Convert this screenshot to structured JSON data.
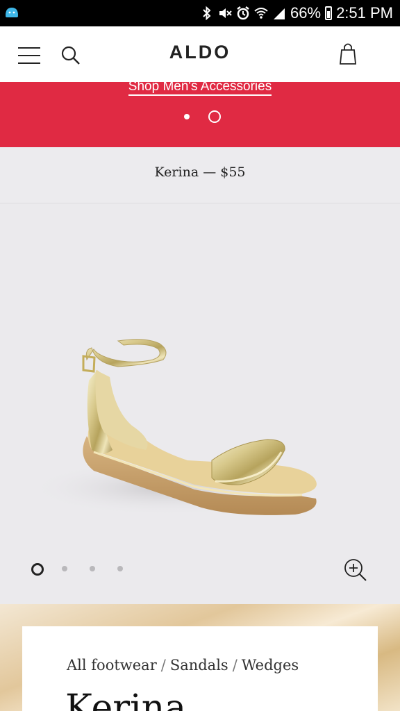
{
  "status_bar": {
    "battery": "66%",
    "time": "2:51 PM",
    "icons": [
      "app-notification-icon",
      "bluetooth-icon",
      "mute-icon",
      "alarm-icon",
      "wifi-icon",
      "signal-icon",
      "battery-icon"
    ]
  },
  "header": {
    "logo": "ALDO",
    "icons": [
      "menu-icon",
      "search-icon",
      "shopping-bag-icon"
    ]
  },
  "promo": {
    "link_text": "Shop Men's Accessories",
    "background": "#e02a43",
    "slide_count": 2,
    "active_slide": 2
  },
  "product_title_bar": {
    "text": "Kerina — $55"
  },
  "gallery": {
    "image_count": 4,
    "active_image": 1,
    "zoom_icon": "zoom-in-icon"
  },
  "details": {
    "breadcrumb": [
      "All footwear",
      "Sandals",
      "Wedges"
    ],
    "breadcrumb_separator": "/",
    "product_name": "Kerina"
  }
}
